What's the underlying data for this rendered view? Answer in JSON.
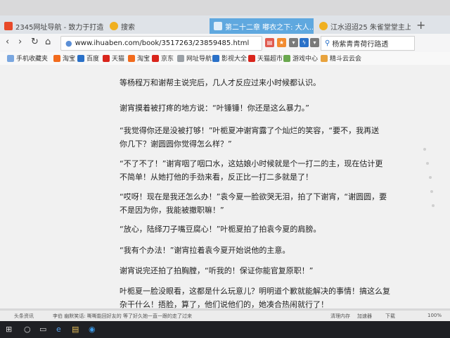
{
  "tabs": [
    {
      "title": "2345网址导航 - 致力于打造百",
      "icon": "2345-logo-icon",
      "color": "#e84a2a"
    },
    {
      "title": "搜索",
      "icon": "search-logo-icon",
      "color": "#f0b020"
    },
    {
      "title": "第二十二章 嘟衣之下: 大人...",
      "icon": "book-page-icon",
      "color": "#ffffff"
    },
    {
      "title": "江水迢迢25 朱雀堂堂主上官",
      "icon": "book-page-icon",
      "color": "#f0b020"
    }
  ],
  "new_tab": "+",
  "address": {
    "url": "www.ihuaben.com/book/3517263/23859485.html",
    "search_text": "杨紫青青荷行路透"
  },
  "bookmarks": [
    {
      "label": "手机收藏夹",
      "color": "#7aa7e0"
    },
    {
      "label": "淘宝",
      "color": "#f26b1d"
    },
    {
      "label": "百度",
      "color": "#2a71c8"
    },
    {
      "label": "天猫",
      "color": "#d9251c"
    },
    {
      "label": "淘宝",
      "color": "#f26b1d"
    },
    {
      "label": "京东",
      "color": "#d9251c"
    },
    {
      "label": "网址导航",
      "color": "#9aa0a6"
    },
    {
      "label": "影视大全",
      "color": "#2a71c8"
    },
    {
      "label": "天猫超市",
      "color": "#d9251c"
    },
    {
      "label": "游戏中心",
      "color": "#6aa84f"
    },
    {
      "label": "精斗云云会",
      "color": "#e8a33d"
    }
  ],
  "paragraphs": [
    "等杨程万和谢帮主说完后，几人才反应过来小时候都认识。",
    "谢宵摸着被打疼的地方说：“叶锤锤！你还是这么暴力。”",
    "“我觉得你还是没被打够！”叶栀夏冲谢宵露了个灿烂的笑容，“要不，我再送你几下？谢圆圆你觉得怎么样？”",
    "“不了不了！”谢宵咽了咽口水，这姑娘小时候就是个一打二的主，现在估计更不简单！从她打他的手劲来看，反正比一打二多就是了！",
    "“哎呀！现在是我还怎么办！”袁今夏一脸欲哭无泪，拍了下谢宵，“谢圆圆，要不是因为你，我能被撤职嘛！”",
    "“放心，陆绎刀子嘴豆腐心！”叶栀夏拍了拍袁今夏的肩膀。",
    "“我有个办法！”谢宵拉着袁今夏开始说他的主意。",
    "谢宵说完还拍了拍胸膛，“听我的！保证你能官复原职！”",
    "叶栀夏一脸没眼看，这都是什么玩意儿？明明道个歉就能解决的事情！搞这么复杂干什么！捂脸，算了，他们说他们的，她凑合热闹就行了！"
  ],
  "status": {
    "left": "头条资讯",
    "news": "李伯 幽默笑话: 嘶嘶能回好友的 等了好久她一直一跟的走了过来",
    "right1": "清理内存",
    "right2": "加速器",
    "right3": "下载",
    "zoom": "100%"
  },
  "taskbar": {
    "start": "⊞",
    "items": [
      "○",
      "▭",
      "e",
      "▤",
      "◉"
    ]
  }
}
